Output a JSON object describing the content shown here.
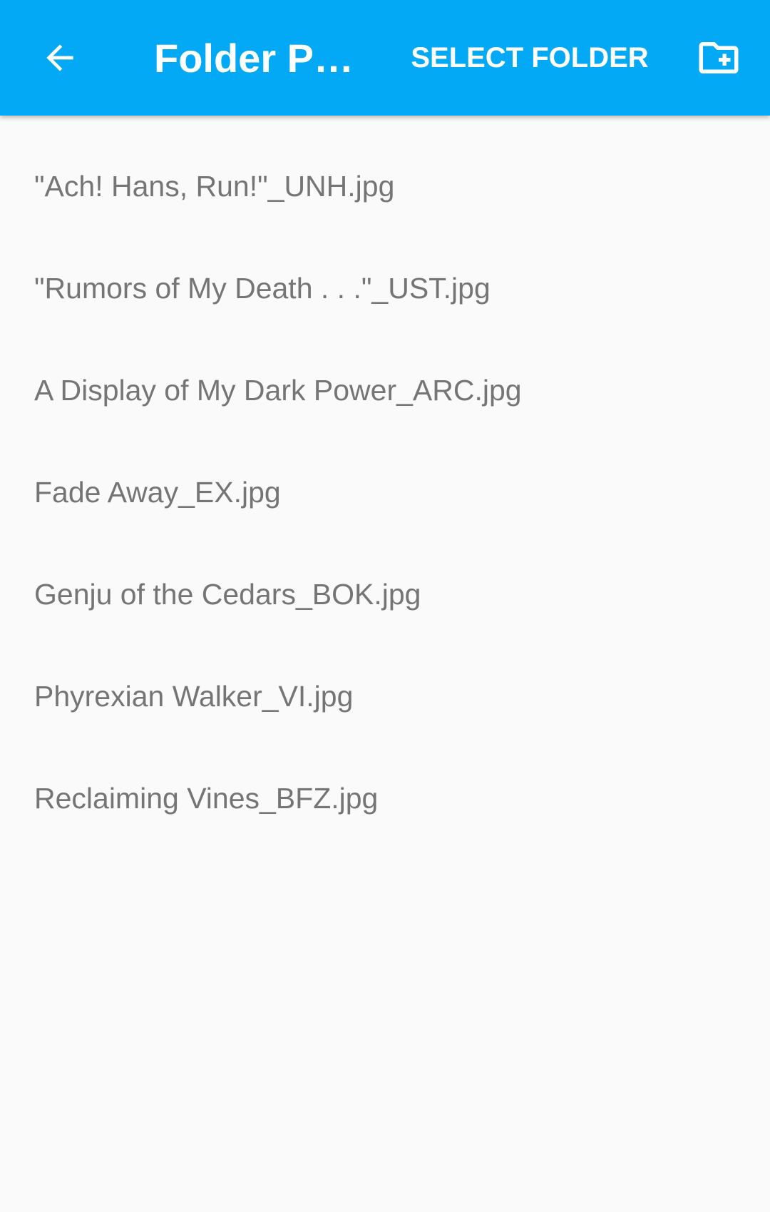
{
  "app_bar": {
    "title": "Folder Pi…",
    "select_label": "SELECT FOLDER",
    "back_icon": "arrow-back-icon",
    "new_folder_icon": "create-new-folder-icon",
    "background_color": "#03a9f4"
  },
  "files": [
    {
      "name": "\"Ach! Hans, Run!\"_UNH.jpg"
    },
    {
      "name": "\"Rumors of My Death . . .\"_UST.jpg"
    },
    {
      "name": "A Display of My Dark Power_ARC.jpg"
    },
    {
      "name": "Fade Away_EX.jpg"
    },
    {
      "name": "Genju of the Cedars_BOK.jpg"
    },
    {
      "name": "Phyrexian Walker_VI.jpg"
    },
    {
      "name": "Reclaiming Vines_BFZ.jpg"
    }
  ]
}
